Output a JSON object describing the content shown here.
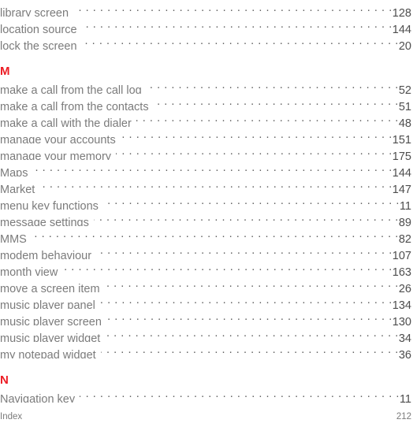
{
  "document": {
    "type": "index",
    "colors": {
      "section_heading": "#ec1c24",
      "entry_text": "#7b7b7b",
      "page_number": "#4d4d4d",
      "leader_dots": "#5f5f5f",
      "footer_text": "#7b7b7b",
      "background": "#ffffff"
    }
  },
  "entries_top": [
    {
      "label": "library screen",
      "page": "128"
    },
    {
      "label": "location source",
      "page": "144"
    },
    {
      "label": "lock the screen",
      "page": "20"
    }
  ],
  "sections": [
    {
      "letter": "M",
      "entries": [
        {
          "label": "make a call from the call log",
          "page": "52"
        },
        {
          "label": "make a call from the contacts",
          "page": "51"
        },
        {
          "label": "make a call with the dialer",
          "page": "48"
        },
        {
          "label": "manage your accounts",
          "page": "151"
        },
        {
          "label": "manage your memory",
          "page": "175"
        },
        {
          "label": "Maps",
          "page": "144"
        },
        {
          "label": "Market",
          "page": "147"
        },
        {
          "label": "menu key functions",
          "page": "11"
        },
        {
          "label": "message settings",
          "page": "89"
        },
        {
          "label": "MMS",
          "page": "82"
        },
        {
          "label": "modem behaviour",
          "page": "107"
        },
        {
          "label": "month view",
          "page": "163"
        },
        {
          "label": "move a screen item",
          "page": "26"
        },
        {
          "label": "music player panel",
          "page": "134"
        },
        {
          "label": "music player screen",
          "page": "130"
        },
        {
          "label": "music player widget",
          "page": "34"
        },
        {
          "label": "my notepad widget",
          "page": "36"
        }
      ]
    },
    {
      "letter": "N",
      "entries": [
        {
          "label": "Navigation key",
          "page": "11"
        }
      ]
    }
  ],
  "footer": {
    "label": "Index",
    "page": "212"
  }
}
